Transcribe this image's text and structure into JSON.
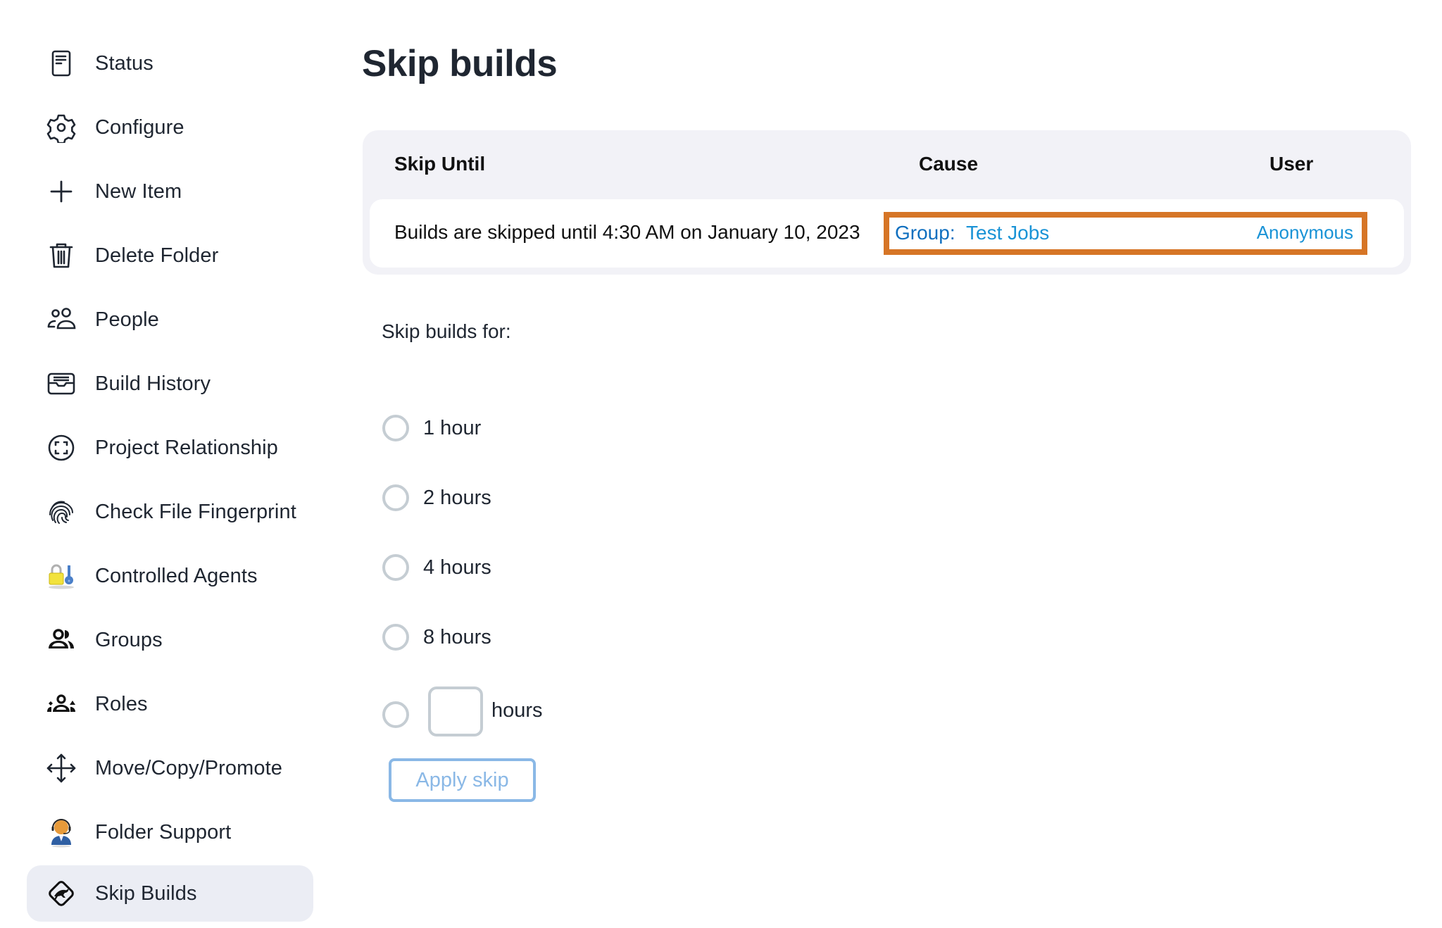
{
  "sidebar": {
    "items": [
      {
        "label": "Status",
        "icon": "status-document-icon"
      },
      {
        "label": "Configure",
        "icon": "gear-icon"
      },
      {
        "label": "New Item",
        "icon": "plus-icon"
      },
      {
        "label": "Delete Folder",
        "icon": "trash-icon"
      },
      {
        "label": "People",
        "icon": "people-icon"
      },
      {
        "label": "Build History",
        "icon": "inbox-tray-icon"
      },
      {
        "label": "Project Relationship",
        "icon": "focus-circle-icon"
      },
      {
        "label": "Check File Fingerprint",
        "icon": "fingerprint-icon"
      },
      {
        "label": "Controlled Agents",
        "icon": "lock-and-key-icon"
      },
      {
        "label": "Groups",
        "icon": "groups-icon"
      },
      {
        "label": "Roles",
        "icon": "roles-icon"
      },
      {
        "label": "Move/Copy/Promote",
        "icon": "move-arrows-icon"
      },
      {
        "label": "Folder Support",
        "icon": "support-agent-icon"
      },
      {
        "label": "Skip Builds",
        "icon": "kangaroo-sign-icon",
        "active": true
      }
    ]
  },
  "main": {
    "title": "Skip builds",
    "table": {
      "headers": {
        "skip_until": "Skip Until",
        "cause": "Cause",
        "user": "User"
      },
      "rows": [
        {
          "skip_until": "Builds are skipped until 4:30 AM on January 10, 2023",
          "cause_prefix": "Group:",
          "cause_link": "Test Jobs",
          "user": "Anonymous"
        }
      ]
    },
    "skip_for": {
      "label": "Skip builds for:",
      "options": [
        "1 hour",
        "2 hours",
        "4 hours",
        "8 hours"
      ],
      "custom_value": "",
      "custom_suffix": "hours",
      "apply_label": "Apply skip"
    }
  },
  "colors": {
    "highlight": "#d67526",
    "link": "#1a93d6",
    "active_item_bg": "#ebedf4",
    "table_bg": "#f2f2f7",
    "apply_button": "#8ab8e6"
  }
}
